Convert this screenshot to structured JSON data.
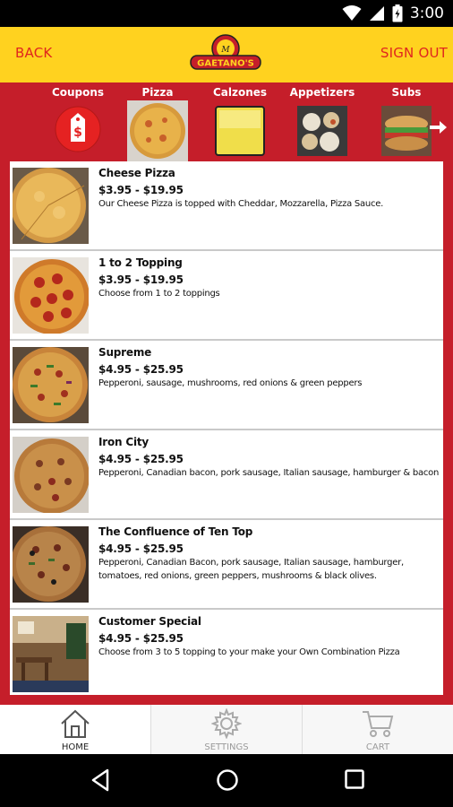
{
  "status_bar": {
    "time": "3:00"
  },
  "header": {
    "back_label": "BACK",
    "signout_label": "SIGN OUT",
    "logo_text": "GAETANO'S"
  },
  "categories": [
    {
      "label": "Coupons"
    },
    {
      "label": "Pizza"
    },
    {
      "label": "Calzones"
    },
    {
      "label": "Appetizers"
    },
    {
      "label": "Subs"
    }
  ],
  "menu_items": [
    {
      "name": "Cheese Pizza",
      "price": "$3.95 - $19.95",
      "description": "Our Cheese Pizza is topped with Cheddar, Mozzarella, Pizza Sauce."
    },
    {
      "name": "1 to 2 Topping",
      "price": "$3.95 - $19.95",
      "description": "Choose from 1 to 2 toppings"
    },
    {
      "name": "Supreme",
      "price": "$4.95 - $25.95",
      "description": "Pepperoni, sausage, mushrooms, red onions & green peppers"
    },
    {
      "name": "Iron City",
      "price": "$4.95 - $25.95",
      "description": "Pepperoni, Canadian bacon, pork sausage, Italian sausage, hamburger & bacon"
    },
    {
      "name": "The Confluence of Ten Top",
      "price": "$4.95 - $25.95",
      "description": "Pepperoni, Canadian Bacon, pork sausage, Italian sausage, hamburger, tomatoes, red onions, green peppers, mushrooms & black olives."
    },
    {
      "name": "Customer Special",
      "price": "$4.95 - $25.95",
      "description": "Choose from 3 to 5 topping to your make your Own Combination Pizza"
    }
  ],
  "tabs": [
    {
      "label": "HOME",
      "icon": "home-icon",
      "active": true
    },
    {
      "label": "SETTINGS",
      "icon": "gear-icon",
      "active": false
    },
    {
      "label": "CART",
      "icon": "cart-icon",
      "active": false
    }
  ],
  "colors": {
    "header": "#ffd21f",
    "brand_red": "#c51e2a",
    "text_red": "#e0261e"
  }
}
